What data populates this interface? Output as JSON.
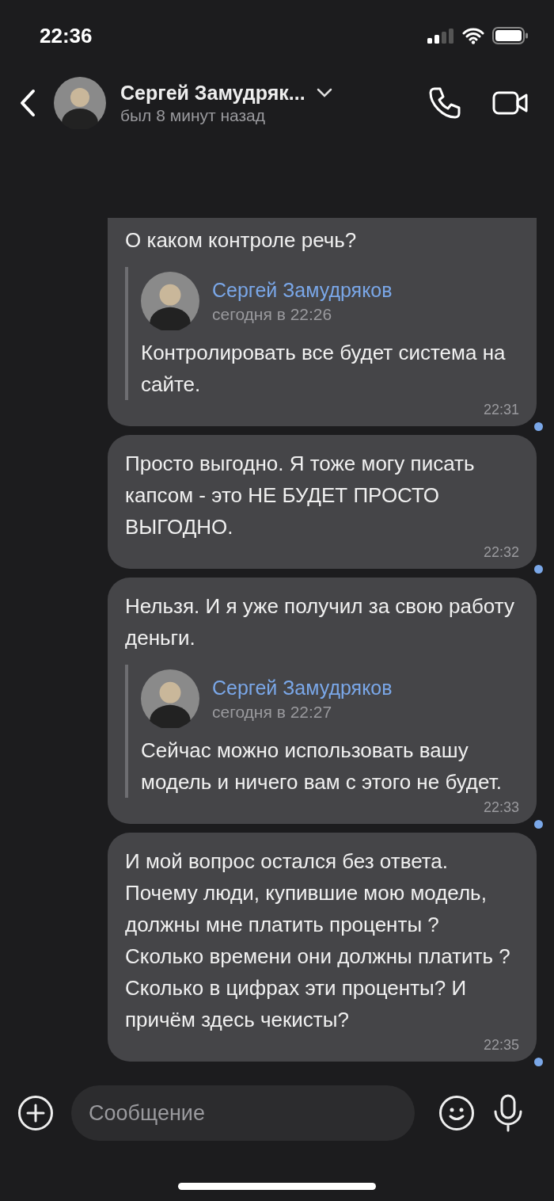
{
  "status_bar": {
    "time": "22:36"
  },
  "header": {
    "name": "Сергей Замудряк...",
    "status": "был 8 минут назад"
  },
  "messages": [
    {
      "text": "О каком контроле речь?",
      "quote": {
        "author": "Сергей Замудряков",
        "time": "сегодня в 22:26",
        "text": "Контролировать все будет система на сайте."
      },
      "time": "22:31",
      "unread": true
    },
    {
      "text": "Просто выгодно. Я тоже могу писать капсом - это НЕ БУДЕТ ПРОСТО ВЫГОДНО.",
      "time": "22:32",
      "unread": true
    },
    {
      "text": "Нельзя. И я уже получил за свою работу деньги.",
      "quote": {
        "author": "Сергей Замудряков",
        "time": "сегодня в 22:27",
        "text": "Сейчас можно использовать вашу модель и ничего вам с этого не будет."
      },
      "time": "22:33",
      "unread": true
    },
    {
      "text": "И мой вопрос остался без ответа. Почему люди, купившие мою модель,  должны мне платить проценты ? Сколько времени они должны платить ? Сколько в цифрах эти проценты? И причём здесь чекисты?",
      "time": "22:35",
      "unread": true
    }
  ],
  "composer": {
    "placeholder": "Сообщение"
  }
}
